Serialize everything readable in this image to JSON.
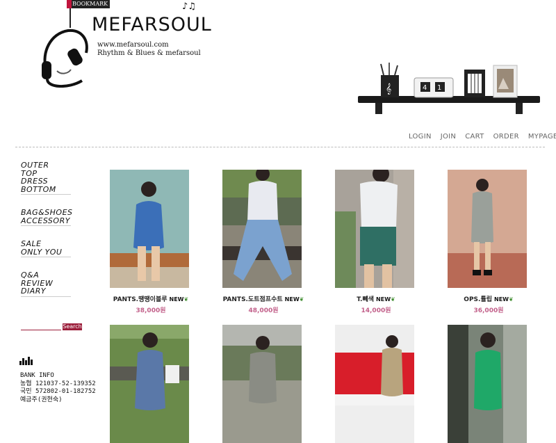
{
  "header": {
    "bookmark": "BOOKMARK",
    "brand": "MEFARSOUL",
    "url": "www.mefarsoul.com",
    "tagline": "Rhythm & Blues & mefarsoul",
    "clock_digits": [
      "4",
      "1"
    ]
  },
  "nav": [
    "LOGIN",
    "JOIN",
    "CART",
    "ORDER",
    "MYPAGE"
  ],
  "sidebar": {
    "groups": [
      [
        "OUTER",
        "TOP",
        "DRESS",
        "BOTTOM"
      ],
      [
        "BAG&SHOES",
        "ACCESSORY"
      ],
      [
        "SALE",
        "ONLY YOU"
      ],
      [
        "Q&A",
        "REVIEW",
        "DIARY"
      ]
    ],
    "search_label": "Search",
    "bank": [
      "BANK INFO",
      "농협 121037-52-139352",
      "국민 572802-01-182752",
      "예금주(권현숙)"
    ]
  },
  "products": [
    {
      "name": "PANTS.땡땡이블루",
      "price": "38,000원",
      "badge": "NEW"
    },
    {
      "name": "PANTS.도트점프수트",
      "price": "48,000원",
      "badge": "NEW"
    },
    {
      "name": "T.뻬색",
      "price": "14,000원",
      "badge": "NEW"
    },
    {
      "name": "OPS.튤립",
      "price": "36,000원",
      "badge": "NEW"
    }
  ],
  "colors": {
    "accent": "#9b1d3a",
    "price": "#c2608a"
  }
}
